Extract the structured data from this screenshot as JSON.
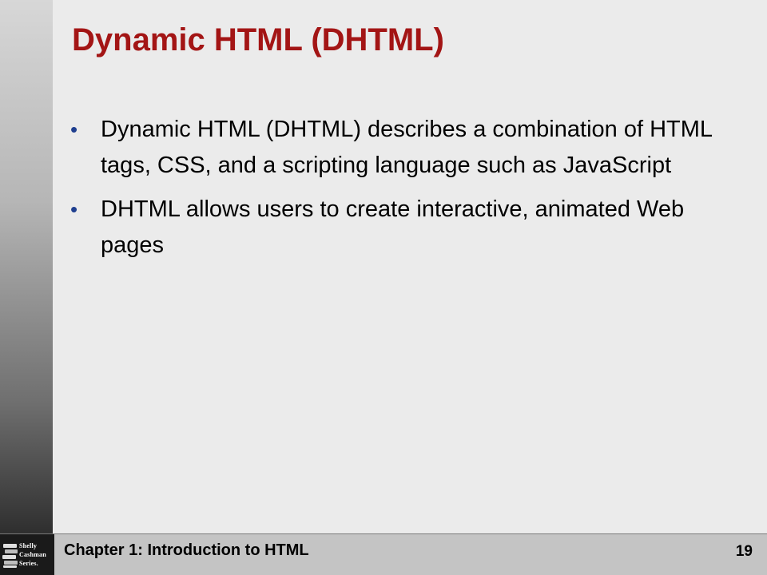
{
  "slide": {
    "title": "Dynamic HTML (DHTML)",
    "bullets": [
      {
        "text": "Dynamic HTML (DHTML) describes a combination of HTML tags, CSS, and a scripting language such as JavaScript"
      },
      {
        "text": "DHTML allows users to create interactive, animated Web pages"
      }
    ],
    "bullet_symbol": "•"
  },
  "footer": {
    "chapter": "Chapter 1: Introduction to HTML",
    "page_number": "19"
  },
  "logo": {
    "lines": [
      "Shelly",
      "Cashman",
      "Series."
    ],
    "icon": "stacked-books-icon"
  },
  "colors": {
    "title": "#a31515",
    "bullet": "#1f3f8f",
    "background": "#ebebeb",
    "footer": "#c4c4c4"
  }
}
